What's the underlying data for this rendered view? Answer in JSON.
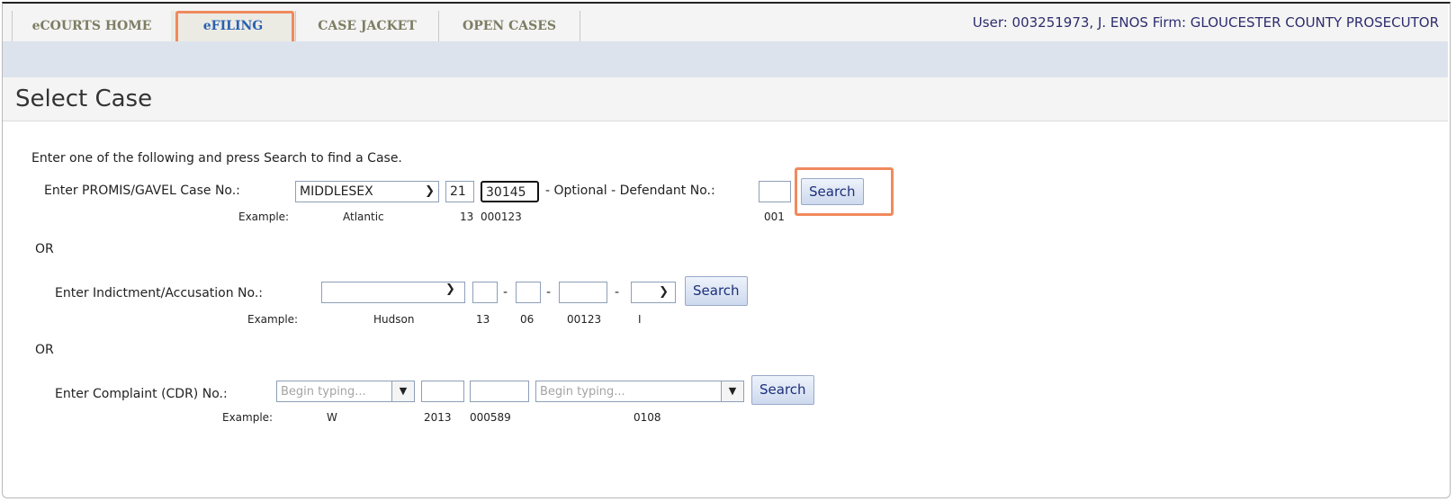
{
  "nav": {
    "tabs": [
      {
        "label": "eCOURTS HOME"
      },
      {
        "label": "eFILING"
      },
      {
        "label": "CASE JACKET"
      },
      {
        "label": "OPEN CASES"
      }
    ],
    "user_info": "User: 003251973, J. ENOS  Firm: GLOUCESTER COUNTY PROSECUTOR"
  },
  "page_title": "Select Case",
  "instructions": "Enter one of the following and press Search to find a Case.",
  "promis": {
    "label": "Enter PROMIS/GAVEL Case No.:",
    "county": "MIDDLESEX",
    "year": "21",
    "number": "30145",
    "optional_label": "- Optional - Defendant No.:",
    "defendant": "",
    "search": "Search",
    "example_label": "Example:",
    "example_county": "Atlantic",
    "example_year": "13",
    "example_number": "000123",
    "example_defendant": "001"
  },
  "or_1": "OR",
  "indictment": {
    "label": "Enter Indictment/Accusation No.:",
    "county": "",
    "sep": "-",
    "search": "Search",
    "example_label": "Example:",
    "example_county": "Hudson",
    "example_year": "13",
    "example_month": "06",
    "example_number": "00123",
    "example_type": "I"
  },
  "or_2": "OR",
  "complaint": {
    "label": "Enter Complaint (CDR) No.:",
    "placeholder_1": "Begin typing...",
    "placeholder_2": "Begin typing...",
    "search": "Search",
    "example_label": "Example:",
    "example_type": "W",
    "example_year": "2013",
    "example_number": "000589",
    "example_code": "0108"
  }
}
